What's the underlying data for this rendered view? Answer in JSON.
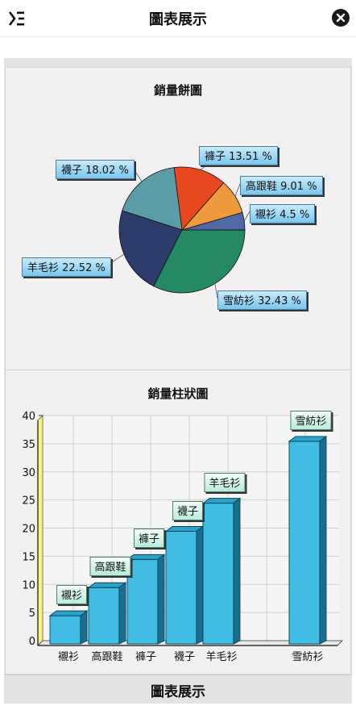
{
  "header": {
    "title": "圖表展示",
    "menu_icon": "menu-icon",
    "close_icon": "close-icon"
  },
  "footer": {
    "title": "圖表展示"
  },
  "chart_data": [
    {
      "type": "pie",
      "title": "銷量餅圖",
      "slices": [
        {
          "name": "襯衫",
          "percent": 4.5,
          "label": "襯衫 4.5 %",
          "color": "#5068a4"
        },
        {
          "name": "高跟鞋",
          "percent": 9.01,
          "label": "高跟鞋 9.01 %",
          "color": "#ef9a3c"
        },
        {
          "name": "褲子",
          "percent": 13.51,
          "label": "褲子 13.51 %",
          "color": "#e8481e"
        },
        {
          "name": "襪子",
          "percent": 18.02,
          "label": "襪子 18.02 %",
          "color": "#5b9da6"
        },
        {
          "name": "羊毛衫",
          "percent": 22.52,
          "label": "羊毛衫 22.52 %",
          "color": "#2b3b6a"
        },
        {
          "name": "雪紡衫",
          "percent": 32.43,
          "label": "雪紡衫 32.43 %",
          "color": "#238a64"
        }
      ]
    },
    {
      "type": "bar",
      "title": "銷量柱狀圖",
      "categories": [
        "襯衫",
        "高跟鞋",
        "褲子",
        "襪子",
        "羊毛衫",
        "雪紡衫"
      ],
      "values": [
        5,
        10,
        15,
        20,
        25,
        36
      ],
      "ylim": [
        0,
        40
      ],
      "yticks": [
        "0",
        "5",
        "10",
        "15",
        "20",
        "25",
        "30",
        "35",
        "40"
      ],
      "grid": true,
      "bar_color": "#3fbde2"
    }
  ]
}
